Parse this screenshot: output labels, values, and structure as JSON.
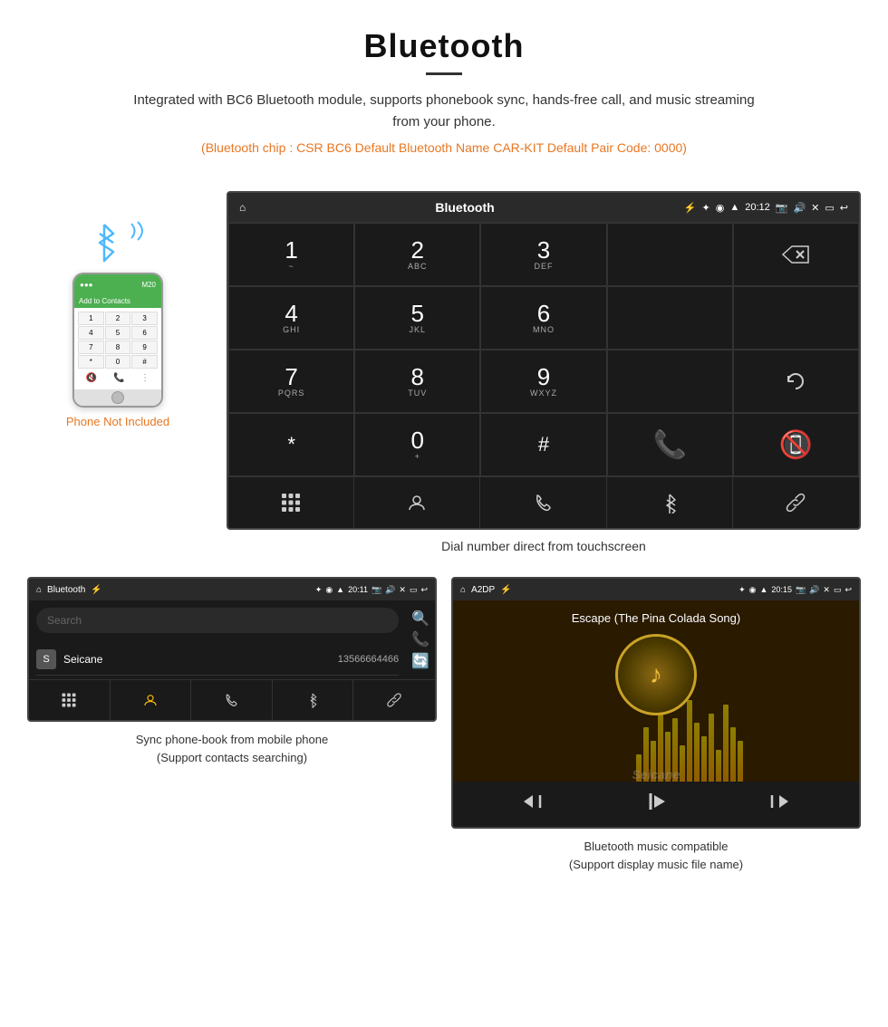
{
  "header": {
    "title": "Bluetooth",
    "description": "Integrated with BC6 Bluetooth module, supports phonebook sync, hands-free call, and music streaming from your phone.",
    "specs": "(Bluetooth chip : CSR BC6   Default Bluetooth Name CAR-KIT    Default Pair Code: 0000)"
  },
  "phone": {
    "not_included_label": "Phone Not Included",
    "add_contacts": "Add to Contacts",
    "top_bar_text": "M20",
    "keys": [
      "1",
      "2",
      "3",
      "4",
      "5",
      "6",
      "*",
      "0",
      "#"
    ]
  },
  "dial_screen": {
    "title": "Bluetooth",
    "time": "20:12",
    "caption": "Dial number direct from touchscreen",
    "keys": [
      {
        "number": "1",
        "letters": "~"
      },
      {
        "number": "2",
        "letters": "ABC"
      },
      {
        "number": "3",
        "letters": "DEF"
      },
      {
        "number": "4",
        "letters": "GHI"
      },
      {
        "number": "5",
        "letters": "JKL"
      },
      {
        "number": "6",
        "letters": "MNO"
      },
      {
        "number": "7",
        "letters": "PQRS"
      },
      {
        "number": "8",
        "letters": "TUV"
      },
      {
        "number": "9",
        "letters": "WXYZ"
      },
      {
        "number": "*",
        "letters": ""
      },
      {
        "number": "0",
        "letters": "+"
      },
      {
        "number": "#",
        "letters": ""
      }
    ]
  },
  "phonebook_screen": {
    "title": "Bluetooth",
    "time": "20:11",
    "search_placeholder": "Search",
    "entry": {
      "initial": "S",
      "name": "Seicane",
      "number": "13566664466"
    },
    "caption_line1": "Sync phone-book from mobile phone",
    "caption_line2": "(Support contacts searching)"
  },
  "a2dp_screen": {
    "title": "A2DP",
    "time": "20:15",
    "song_title": "Escape (The Pina Colada Song)",
    "eq_bars": [
      30,
      60,
      45,
      80,
      55,
      70,
      40,
      90,
      65,
      50,
      75,
      35,
      85,
      60,
      45
    ],
    "caption_line1": "Bluetooth music compatible",
    "caption_line2": "(Support display music file name)"
  },
  "colors": {
    "accent_orange": "#e87722",
    "android_bg": "#1a1a1a",
    "android_statusbar": "#2a2a2a",
    "call_green": "#4caf50",
    "end_red": "#f44336",
    "bluetooth_blue": "#4db8ff"
  }
}
